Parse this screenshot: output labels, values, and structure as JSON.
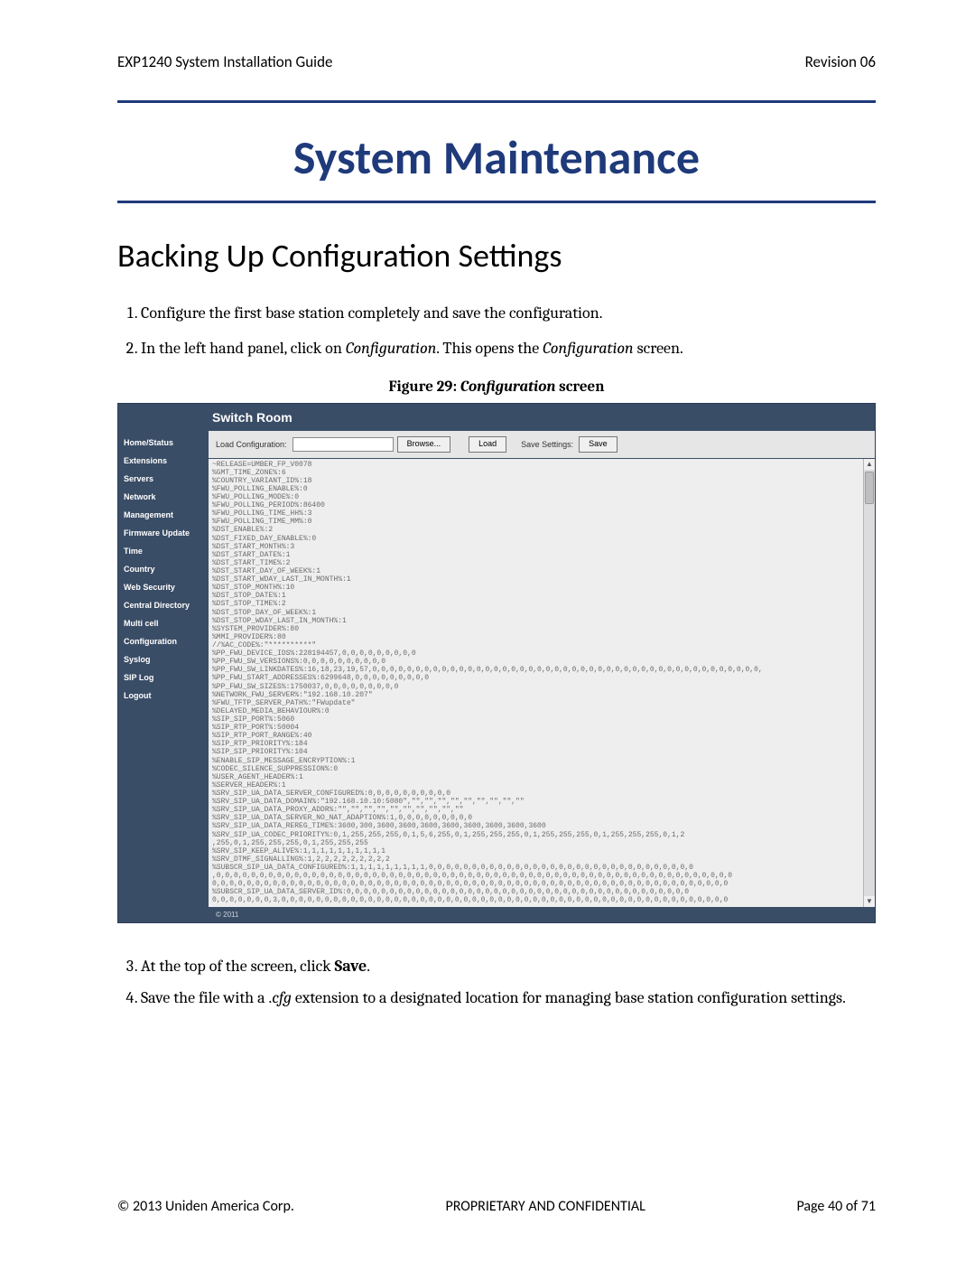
{
  "header": {
    "left": "EXP1240 System Installation Guide",
    "right": "Revision 06"
  },
  "title": "System Maintenance",
  "section": "Backing Up Configuration Settings",
  "steps_a": [
    "Configure the first base station completely and save the configuration.",
    "In the left hand panel, click on Configuration. This opens the Configuration screen."
  ],
  "figure": {
    "label": "Figure 29: ",
    "name": "Configuration",
    "suffix": " screen"
  },
  "screenshot": {
    "title": "Switch Room",
    "nav": [
      "Home/Status",
      "Extensions",
      "Servers",
      "Network",
      "Management",
      "Firmware Update",
      "Time",
      "Country",
      "Web Security",
      "Central Directory",
      "Multi cell",
      "Configuration",
      "Syslog",
      "SIP Log",
      "Logout"
    ],
    "toolbar": {
      "load_label": "Load Configuration:",
      "browse": "Browse...",
      "load": "Load",
      "save_label": "Save Settings:",
      "save": "Save"
    },
    "config_text": "~RELEASE=UMBER_FP_V0078\n%GMT_TIME_ZONE%:6\n%COUNTRY_VARIANT_ID%:18\n%FWU_POLLING_ENABLE%:0\n%FWU_POLLING_MODE%:0\n%FWU_POLLING_PERIOD%:86400\n%FWU_POLLING_TIME_HH%:3\n%FWU_POLLING_TIME_MM%:0\n%DST_ENABLE%:2\n%DST_FIXED_DAY_ENABLE%:0\n%DST_START_MONTH%:3\n%DST_START_DATE%:1\n%DST_START_TIME%:2\n%DST_START_DAY_OF_WEEK%:1\n%DST_START_WDAY_LAST_IN_MONTH%:1\n%DST_STOP_MONTH%:10\n%DST_STOP_DATE%:1\n%DST_STOP_TIME%:2\n%DST_STOP_DAY_OF_WEEK%:1\n%DST_STOP_WDAY_LAST_IN_MONTH%:1\n%SYSTEM_PROVIDER%:80\n%MMI_PROVIDER%:80\n//%AC_CODE%:\"**********\"\n%PP_FWU_DEVICE_IDS%:228194457,0,0,0,0,0,0,0,0,0\n%PP_FWU_SW_VERSIONS%:0,0,0,0,0,0,0,0,0,0\n%PP_FWU_SW_LINKDATES%:16,18,23,19,57,0,0,0,0,0,0,0,0,0,0,0,0,0,0,0,0,0,0,0,0,0,0,0,0,0,0,0,0,0,0,0,0,0,0,0,0,0,0,0,0,0,0,0,0,0,\n%PP_FWU_START_ADDRESSES%:6299648,0,0,0,0,0,0,0,0,0\n%PP_FWU_SW_SIZES%:1750037,0,0,0,0,0,0,0,0,0\n%NETWORK_FWU_SERVER%:\"192.168.10.207\"\n%FWU_TFTP_SERVER_PATH%:\"FWupdate\"\n%DELAYED_MEDIA_BEHAVIOUR%:0\n%SIP_SIP_PORT%:5060\n%SIP_RTP_PORT%:50004\n%SIP_RTP_PORT_RANGE%:40\n%SIP_RTP_PRIORITY%:184\n%SIP_SIP_PRIORITY%:104\n%ENABLE_SIP_MESSAGE_ENCRYPTION%:1\n%CODEC_SILENCE_SUPPRESSION%:0\n%USER_AGENT_HEADER%:1\n%SERVER_HEADER%:1\n%SRV_SIP_UA_DATA_SERVER_CONFIGURED%:0,0,0,0,0,0,0,0,0,0\n%SRV_SIP_UA_DATA_DOMAIN%:\"192.168.10.10:5080\",\"\",\"\",\"\",\"\",\"\",\"\",\"\",\"\",\"\"\n%SRV_SIP_UA_DATA_PROXY_ADDR%:\"\",\"\",\"\",\"\",\"\",\"\",\"\",\"\",\"\",\"\"\n%SRV_SIP_UA_DATA_SERVER_NO_NAT_ADAPTION%:1,0,0,0,0,0,0,0,0,0\n%SRV_SIP_UA_DATA_REREG_TIME%:3600,300,3600,3600,3600,3600,3600,3600,3600,3600\n%SRV_SIP_UA_CODEC_PRIORITY%:0,1,255,255,255,0,1,5,6,255,0,1,255,255,255,0,1,255,255,255,0,1,255,255,255,0,1,2\n,255,0,1,255,255,255,0,1,255,255,255\n%SRV_SIP_KEEP_ALIVE%:1,1,1,1,1,1,1,1,1,1\n%SRV_DTMF_SIGNALLING%:1,2,2,2,2,2,2,2,2,2\n%SUBSCR_SIP_UA_DATA_CONFIGURED%:1,1,1,1,1,1,1,1,1,0,0,0,0,0,0,0,0,0,0,0,0,0,0,0,0,0,0,0,0,0,0,0,0,0,0,0,0,0,0,0\n,0,0,0,0,0,0,0,0,0,0,0,0,0,0,0,0,0,0,0,0,0,0,0,0,0,0,0,0,0,0,0,0,0,0,0,0,0,0,0,0,0,0,0,0,0,0,0,0,0,0,0,0,0,0,0,0,0,0,0,0\n0,0,0,0,0,0,0,0,0,0,0,0,0,0,0,0,0,0,0,0,0,0,0,0,0,0,0,0,0,0,0,0,0,0,0,0,0,0,0,0,0,0,0,0,0,0,0,0,0,0,0,0,0,0,0,0,0,0,0,0\n%SUBSCR_SIP_UA_DATA_SERVER_ID%:0,0,0,0,0,0,0,0,0,0,0,0,0,0,0,0,0,0,0,0,0,0,0,0,0,0,0,0,0,0,0,0,0,0,0,0,0,0,0,0\n0,0,0,0,0,0,0,3,0,0,0,0,0,0,0,0,0,0,0,0,0,0,0,0,0,0,0,0,0,0,0,0,0,0,0,0,0,0,0,0,0,0,0,0,0,0,0,0,0,0,0,0,0,0,0,0,0,0,0,0",
    "footer": "© 2011"
  },
  "steps_b": {
    "three_pre": "At the top of the screen, click ",
    "three_bold": "Save",
    "three_post": ".",
    "four_pre": "Save the file with a .",
    "four_italic": "cfg",
    "four_post": " extension to a designated location for managing base station configuration settings."
  },
  "footer": {
    "left": "© 2013 Uniden America Corp.",
    "mid": "PROPRIETARY AND CONFIDENTIAL",
    "right": "Page 40 of 71"
  }
}
